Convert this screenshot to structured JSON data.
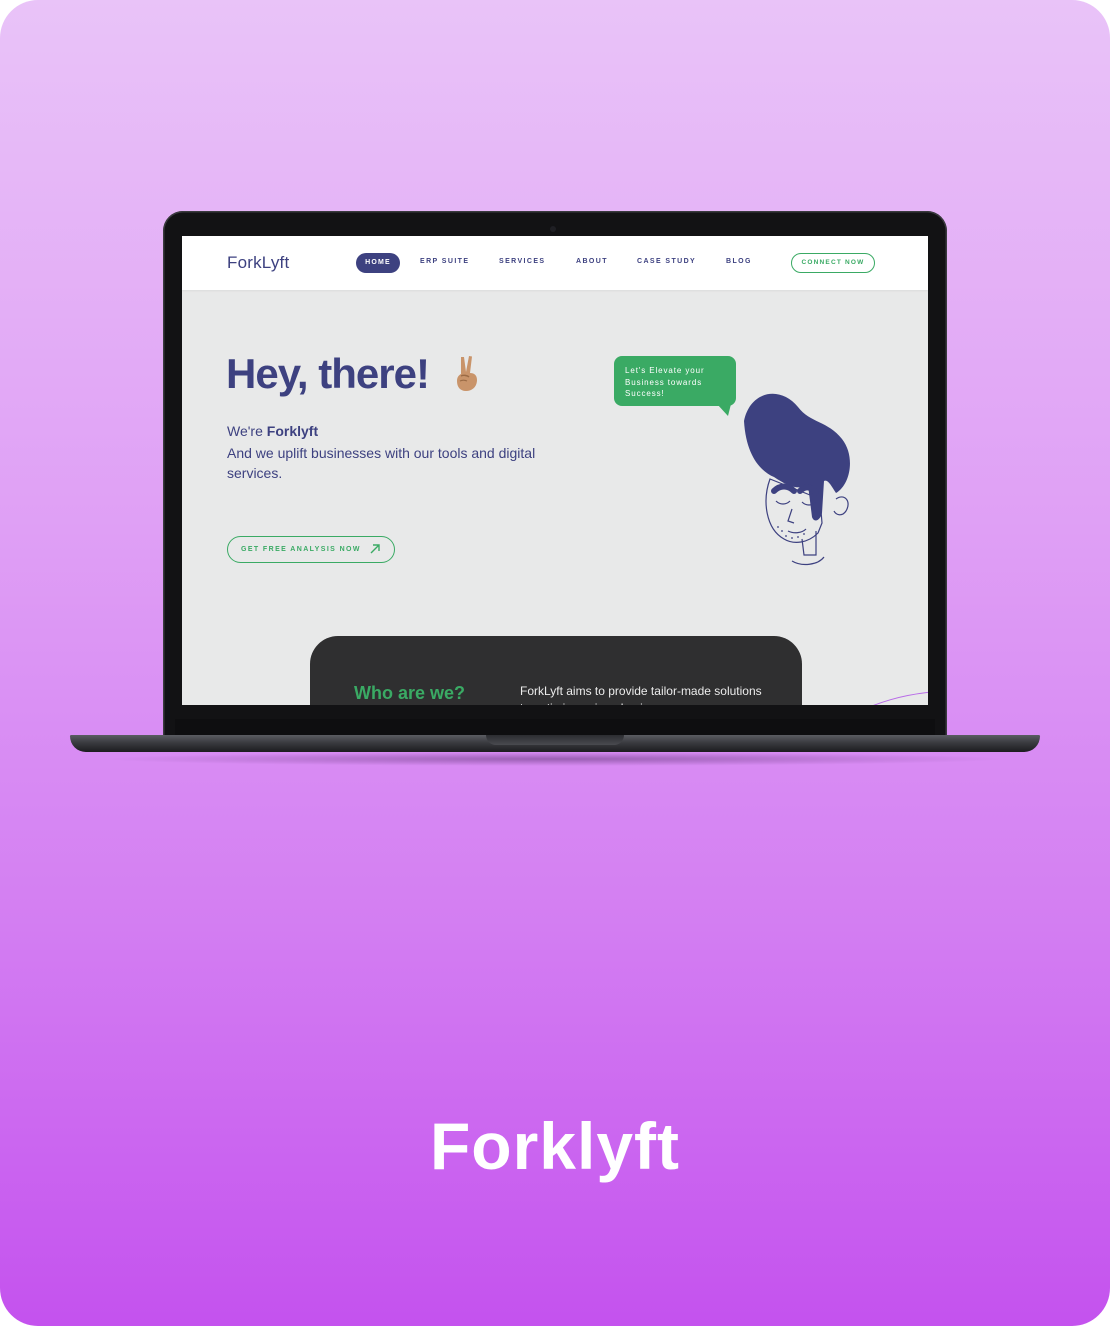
{
  "card": {
    "title": "Forklyft"
  },
  "site": {
    "logo": "ForkLyft",
    "nav": {
      "home": "HOME",
      "erp": "ERP SUITE",
      "services": "SERVICES",
      "about": "ABOUT",
      "case_study": "CASE STUDY",
      "blog": "BLOG",
      "connect": "CONNECT NOW"
    },
    "hero": {
      "title": "Hey, there!",
      "emoji_icon": "victory-hand-icon",
      "intro_prefix": "We're ",
      "intro_brand": "Forklyft",
      "description": "And we uplift businesses with our tools and digital services.",
      "cta": "GET FREE ANALYSIS NOW",
      "cta_icon": "arrow-up-right-icon"
    },
    "bubble": {
      "text": "Let's Elevate your Business towards Success!"
    },
    "about": {
      "heading": "Who are we?",
      "text": "ForkLyft aims to provide tailor-made solutions to optimize unique business"
    }
  },
  "colors": {
    "background_top": "#e9c3f8",
    "background_bottom": "#c452ee",
    "brand_navy": "#3d4180",
    "brand_green": "#3aaa64",
    "dark_card": "#2f2f30"
  }
}
